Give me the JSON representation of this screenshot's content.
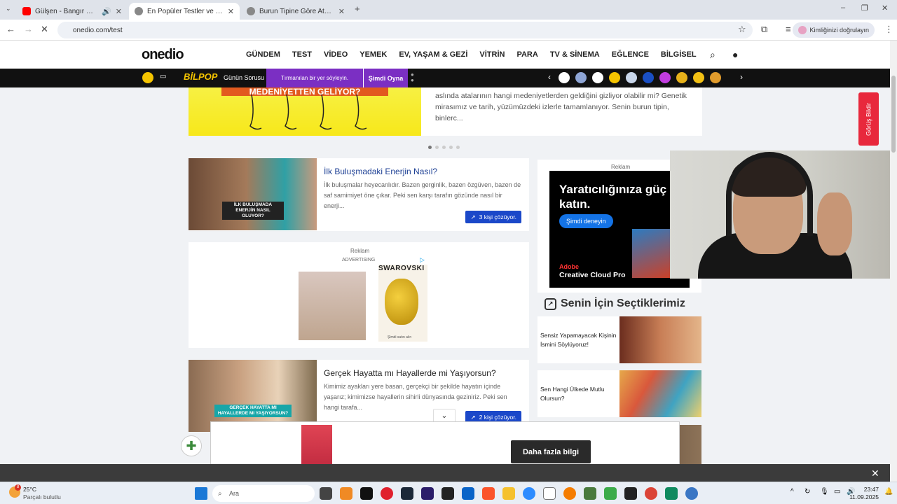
{
  "browser": {
    "tabs": [
      {
        "title": "Gülşen - Bangır Bangır - Yo",
        "active": false
      },
      {
        "title": "En Popüler Testler ve Eğlenceli",
        "active": true
      },
      {
        "title": "Burun Tipine Göre Atalann Han",
        "active": false
      }
    ],
    "url": "onedio.com/test",
    "profile_label": "Kimliğinizi doğrulayın"
  },
  "header": {
    "logo": "onedio",
    "nav": [
      "GÜNDEM",
      "TEST",
      "VİDEO",
      "YEMEK",
      "EV, YAŞAM & GEZİ",
      "VİTRİN",
      "PARA",
      "TV & SİNEMA",
      "EĞLENCE",
      "BİLGİSEL"
    ]
  },
  "bilpop": {
    "logo": "BİLPOP",
    "daily_label": "Günün Sorusu",
    "question": "Tırmanılan bir yer söyleyin.",
    "play_label": "Şimdi Oyna"
  },
  "hero": {
    "banner_text": "MEDENİYETTEN GELİYOR?",
    "description": "aslında atalarının hangi medeniyetlerden geldiğini gizliyor olabilir mi? Genetik mirasımız ve tarih, yüzümüzdeki izlerle tamamlanıyor. Senin burun tipin, binlerc..."
  },
  "cards": [
    {
      "title": "İlk Buluşmadaki Enerjin Nasıl?",
      "description": "İlk buluşmalar heyecanlıdır. Bazen gerginlik, bazen özgüven, bazen de saf samimiyet öne çıkar. Peki sen karşı tarafın gözünde nasıl bir enerji...",
      "solver_label": "3 kişi çözüyor.",
      "caption": "İLK BULUŞMADA ENERJİN NASIL OLUYOR?"
    },
    {
      "title": "Gerçek Hayatta mı Hayallerde mi Yaşıyorsun?",
      "description": "Kimimiz ayakları yere basan, gerçekçi bir şekilde hayatın içinde yaşarız; kimimizse hayallerin sihirli dünyasında geziniriz. Peki sen hangi tarafa...",
      "solver_label": "2 kişi çözüyor.",
      "caption": "GERÇEK HAYATTA MI HAYALLERDE MI YAŞIYORSUN?"
    }
  ],
  "ads": {
    "reklam": "Reklam",
    "advertising": "ADVERTISING",
    "swarovski": "SWAROVSKI",
    "shop": "Şimdi satın alın",
    "adobe_headline": "Yaratıcılığınıza güç katın.",
    "adobe_button": "Şimdi deneyin",
    "adobe_brand": "Adobe",
    "adobe_product": "Creative Cloud Pro",
    "bottom_button": "Daha fazla bilgi"
  },
  "picks": {
    "title": "Senin İçin Seçtiklerimiz",
    "items": [
      {
        "label": "Sensiz Yapamayacak Kişinin İsmini Söylüyoruz!"
      },
      {
        "label": "Sen Hangi Ülkede Mutlu Olursun?"
      }
    ]
  },
  "feedback_label": "Görüş Bildir",
  "taskbar": {
    "temp": "25°C",
    "weather": "Parçalı bulutlu",
    "search": "Ara",
    "time": "23:47",
    "date": "11.09.2025",
    "notif": "8"
  }
}
